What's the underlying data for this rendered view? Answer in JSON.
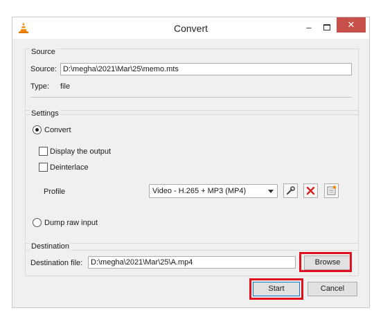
{
  "window": {
    "title": "Convert",
    "close_glyph": "✕",
    "minimize_glyph": "–"
  },
  "source": {
    "group_title": "Source",
    "source_label": "Source:",
    "source_value": "D:\\megha\\2021\\Mar\\25\\memo.mts",
    "type_label": "Type:",
    "type_value": "file"
  },
  "settings": {
    "group_title": "Settings",
    "convert_label": "Convert",
    "display_output_label": "Display the output",
    "deinterlace_label": "Deinterlace",
    "profile_label": "Profile",
    "profile_value": "Video - H.265 + MP3 (MP4)",
    "dump_raw_label": "Dump raw input"
  },
  "destination": {
    "group_title": "Destination",
    "file_label": "Destination file:",
    "file_value": "D:\\megha\\2021\\Mar\\25\\A.mp4",
    "browse_label": "Browse"
  },
  "footer": {
    "start_label": "Start",
    "cancel_label": "Cancel"
  },
  "colors": {
    "highlight": "#e0101e",
    "close_button": "#c7504b",
    "vlc_orange": "#f08a00"
  }
}
